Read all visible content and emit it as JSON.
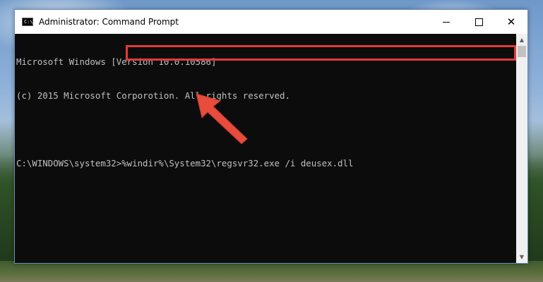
{
  "window": {
    "title": "Administrator: Command Prompt",
    "icon_label": "C:\\_"
  },
  "controls": {
    "minimize": "minimize",
    "maximize": "maximize",
    "close": "✕"
  },
  "console": {
    "lines": [
      "Microsoft Windows [Version 10.0.10586]",
      "(c) 2015 Microsoft Corporotion. All rights reserved.",
      "",
      "C:\\WINDOWS\\system32>%windir%\\System32\\regsvr32.exe /i deusex.dll"
    ]
  },
  "annotation": {
    "highlight_color": "#e23a3a",
    "arrow_color": "#e74c3c"
  },
  "scrollbar": {
    "up_icon": "▲",
    "down_icon": "▼"
  }
}
